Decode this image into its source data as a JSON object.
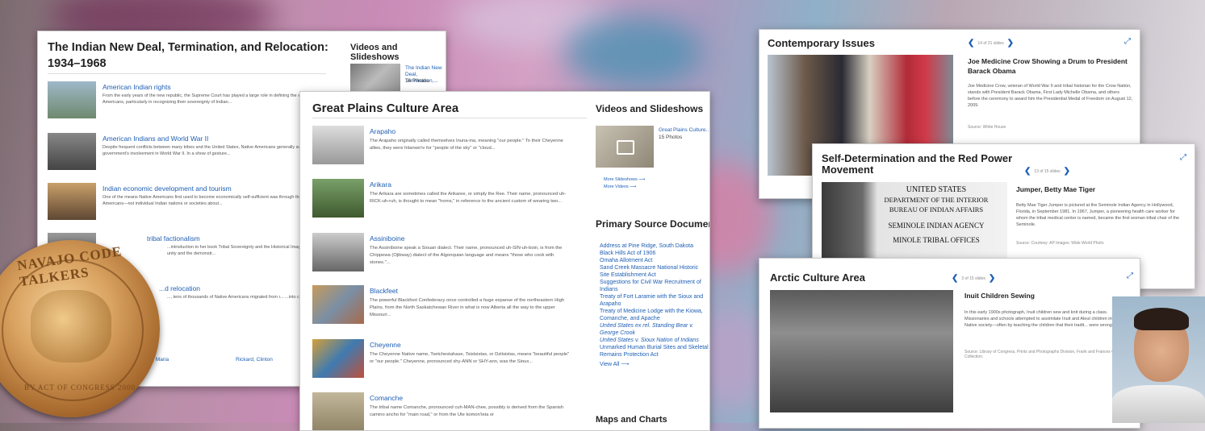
{
  "panel1": {
    "title": "The Indian New Deal, Termination, and Relocation: 1934–1968",
    "side_title": "Videos and Slideshows",
    "side_item": {
      "title": "The Indian New Deal, Termination,...",
      "count": "16 Photos"
    },
    "articles": [
      {
        "title": "American Indian rights",
        "desc": "From the early years of the new republic, the Supreme Court has played a large role in defining the status and rights of Native Americans, particularly in recognizing their sovereignty of Indian..."
      },
      {
        "title": "American Indians and World War II",
        "desc": "Despite frequent conflicts between many tribes and the United States, Native Americans generally supported the federal government's involvement in World War II. In a show of gesture..."
      },
      {
        "title": "Indian economic development and tourism",
        "desc": "One of the means Native Americans first used to become economically self-sufficient was through the promotion of tourism. Native Americans—not individual Indian nations or societies about..."
      },
      {
        "title": "tribal factionalism",
        "desc": "...introduction to her book Tribal Sovereignty and the Historical Imagination, ...ises the question: \"Why do the avowal of tribal unity and the demonstr..."
      },
      {
        "title": "...d relocation",
        "desc": "..., tens of thousands of Native Americans migrated from r... ...into cities. Urbanization signifies both the physical move..."
      }
    ],
    "footer": [
      "...ez, Maria",
      "Rickard, Clinton"
    ]
  },
  "panel2": {
    "title": "Great Plains Culture Area",
    "side_title": "Videos and Slideshows",
    "side_item": {
      "title": "Great Plains Culture...",
      "count": "15 Photos"
    },
    "more_slideshows": "More Slideshows ⟶",
    "more_videos": "More Videos ⟶",
    "primary_title": "Primary Source Documents",
    "primary_links": [
      "Address at Pine Ridge, South Dakota",
      "Black Hills Act of 1906",
      "Omaha Allotment Act",
      "Sand Creek Massacre National Historic Site Establishment Act",
      "Suggestions for Civil War Recruitment of Indians",
      "Treaty of Fort Laramie with the Sioux and Arapaho",
      "Treaty of Medicine Lodge with the Kiowa, Comanche, and Apache",
      "United States ex rel. Standing Bear v. George Crook",
      "United States v. Sioux Nation of Indians",
      "Unmarked Human Burial Sites and Skeletal Remains Protection Act"
    ],
    "view_all": "View All ⟶",
    "maps_title": "Maps and Charts",
    "articles": [
      {
        "title": "Arapaho",
        "desc": "The Arapaho originally called themselves Inuna-ina, meaning \"our people.\" To their Cheyenne allies, they were hitanwo'iv for \"people of the sky\" or \"cloud..."
      },
      {
        "title": "Arikara",
        "desc": "The Arikara are sometimes called the Arikaree, or simply the Ree. Their name, pronounced uh-RICK-uh-ruh, is thought to mean \"horns,\" in reference to the ancient custom of wearing two..."
      },
      {
        "title": "Assiniboine",
        "desc": "The Assiniboine speak a Siouan dialect. Their name, pronounced uh-SIN-uh-boin, is from the Chippewa (Ojibway) dialect of the Algonquian language and means \"those who cook with stones.\"..."
      },
      {
        "title": "Blackfeet",
        "desc": "The powerful Blackfoot Confederacy once controlled a huge expanse of the northeastern High Plains, from the North Saskatchewan River in what is now Alberta all the way to the upper Missouri..."
      },
      {
        "title": "Cheyenne",
        "desc": "The Cheyenne Native name, Tsetchestahase, Tsistsistas, or Dzitsistas, means \"beautiful people\" or \"our people.\" Cheyenne, pronounced shy-ANN or SHY-ann, was the Sioux..."
      },
      {
        "title": "Comanche",
        "desc": "The tribal name Comanche, pronounced cuh-MAN-chee, possibly is derived from the Spanish camino ancho for \"main road,\" or from the Ute komon'teia or"
      }
    ]
  },
  "panel3": {
    "title": "Contemporary Issues",
    "counter": "14 of 21 slides",
    "caption_title": "Joe Medicine Crow Showing a Drum to President Barack Obama",
    "caption": "Joe Medicine Crow, veteran of World War II and tribal historian for the Crow Nation, stands with President Barack Obama, First Lady Michelle Obama, and others before the ceremony to award him the Presidential Medal of Freedom on August 12, 2009.",
    "source": "Source: White House"
  },
  "panel4": {
    "title": "Self-Determination and the Red Power Movement",
    "counter": "13 of 15 slides",
    "caption_title": "Jumper, Betty Mae Tiger",
    "caption": "Betty Mae Tiger Jumper is pictured at the Seminole Indian Agency in Hollywood, Florida, in September 1981. In 1967, Jumper, a pioneering health care worker for whom the tribal medical center is named, became the first woman tribal chair of the Seminole.",
    "source": "Source: Courtesy: AP Images: Wide World Photo",
    "sign_lines": [
      "UNITED STATES",
      "DEPARTMENT OF THE INTERIOR",
      "BUREAU OF INDIAN AFFAIRS",
      "SEMINOLE INDIAN AGENCY",
      "MINOLE TRIBAL OFFICES"
    ]
  },
  "panel5": {
    "title": "Arctic Culture Area",
    "counter": "3 of 15 slides",
    "caption_title": "Inuit Children Sewing",
    "caption": "In this early 1900s photograph, Inuit children sew and knit during a class. Missionaries and schools attempted to assimilate Inuit and Aleut children into non-Native society—often by teaching the children that their tradit... were wrong.",
    "source": "Source: Library of Congress, Prints and Photographs Division, Frank and Frances Car... Collection."
  },
  "medal_text": "NAVAJO CODE TALKERS",
  "medal_bottom": "BY ACT OF CONGRESS 2000"
}
